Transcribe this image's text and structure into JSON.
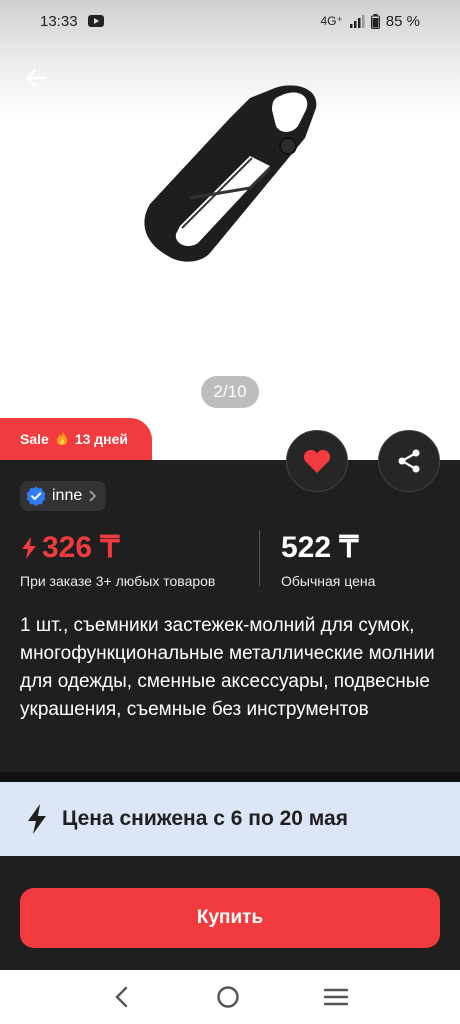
{
  "status_bar": {
    "time": "13:33",
    "network": "4G⁺",
    "battery": "85 %"
  },
  "gallery": {
    "pager": "2/10"
  },
  "sale_badge": {
    "label": "Sale",
    "days": "13 дней"
  },
  "seller": {
    "name": "inne"
  },
  "price": {
    "promo_value": "326 ₸",
    "promo_note": "При заказе 3+ любых товаров",
    "regular_value": "522 ₸",
    "regular_note": "Обычная цена"
  },
  "product": {
    "title": "1 шт., съемники застежек-молний для сумок, многофункциональные металлические молнии для одежды, сменные аксессуары, подвесные украшения, съемные без инструментов"
  },
  "promo_banner": {
    "text": "Цена снижена с 6 по 20 мая"
  },
  "buy_button": {
    "label": "Купить"
  },
  "colors": {
    "accent_red": "#f23b3e",
    "dark_panel": "#1f1f1f",
    "promo_bg": "#dde6f6"
  }
}
